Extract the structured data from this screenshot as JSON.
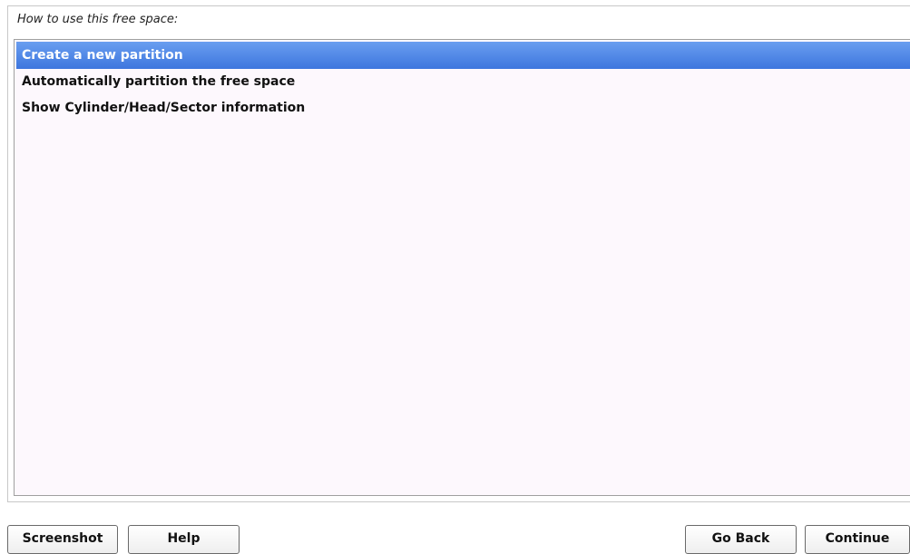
{
  "prompt": "How to use this free space:",
  "options": [
    {
      "label": "Create a new partition",
      "selected": true
    },
    {
      "label": "Automatically partition the free space",
      "selected": false
    },
    {
      "label": "Show Cylinder/Head/Sector information",
      "selected": false
    }
  ],
  "buttons": {
    "screenshot": "Screenshot",
    "help": "Help",
    "go_back": "Go Back",
    "continue": "Continue"
  },
  "colors": {
    "selection": "#3d76de",
    "list_background": "#fdf8fd"
  }
}
